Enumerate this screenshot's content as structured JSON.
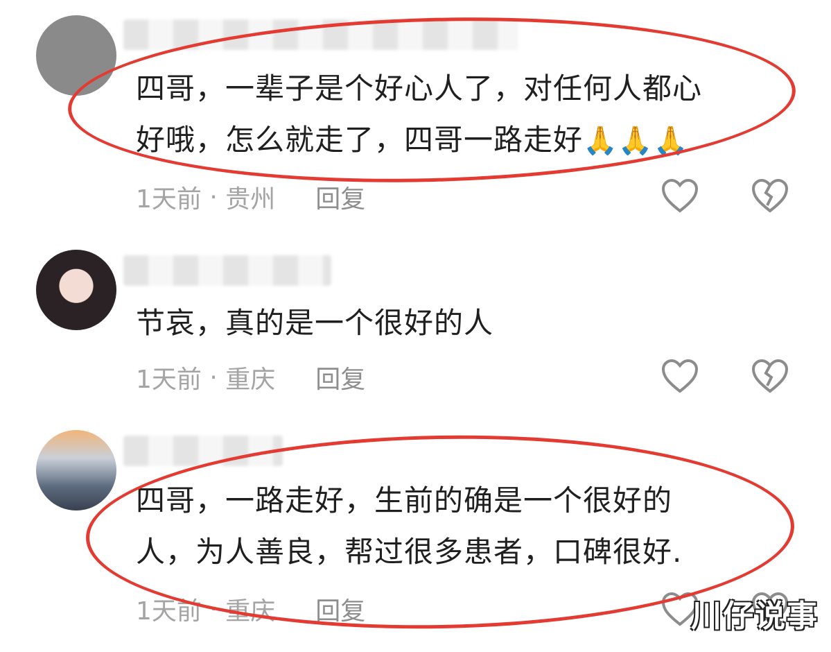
{
  "comments": [
    {
      "lines": [
        "四哥，一辈子是个好心人了，对任何人都心",
        "好哦，怎么就走了，四哥一路走好"
      ],
      "emoji": "🙏🙏🙏",
      "time": "1天前",
      "location": "贵州",
      "reply": "回复"
    },
    {
      "lines": [
        "节哀，真的是一个很好的人"
      ],
      "emoji": "",
      "time": "1天前",
      "location": "重庆",
      "reply": "回复"
    },
    {
      "lines": [
        "四哥，一路走好，生前的确是一个很好的",
        "人，为人善良，帮过很多患者，口碑很好."
      ],
      "emoji": "",
      "time": "1天前",
      "location": "重庆",
      "reply": "回复"
    }
  ],
  "watermark": "川仔说事",
  "colors": {
    "highlight": "#e33a31",
    "meta": "#a4a4a4",
    "text": "#1f1f1f"
  },
  "icons": [
    "heart-outline-icon",
    "broken-heart-icon"
  ]
}
